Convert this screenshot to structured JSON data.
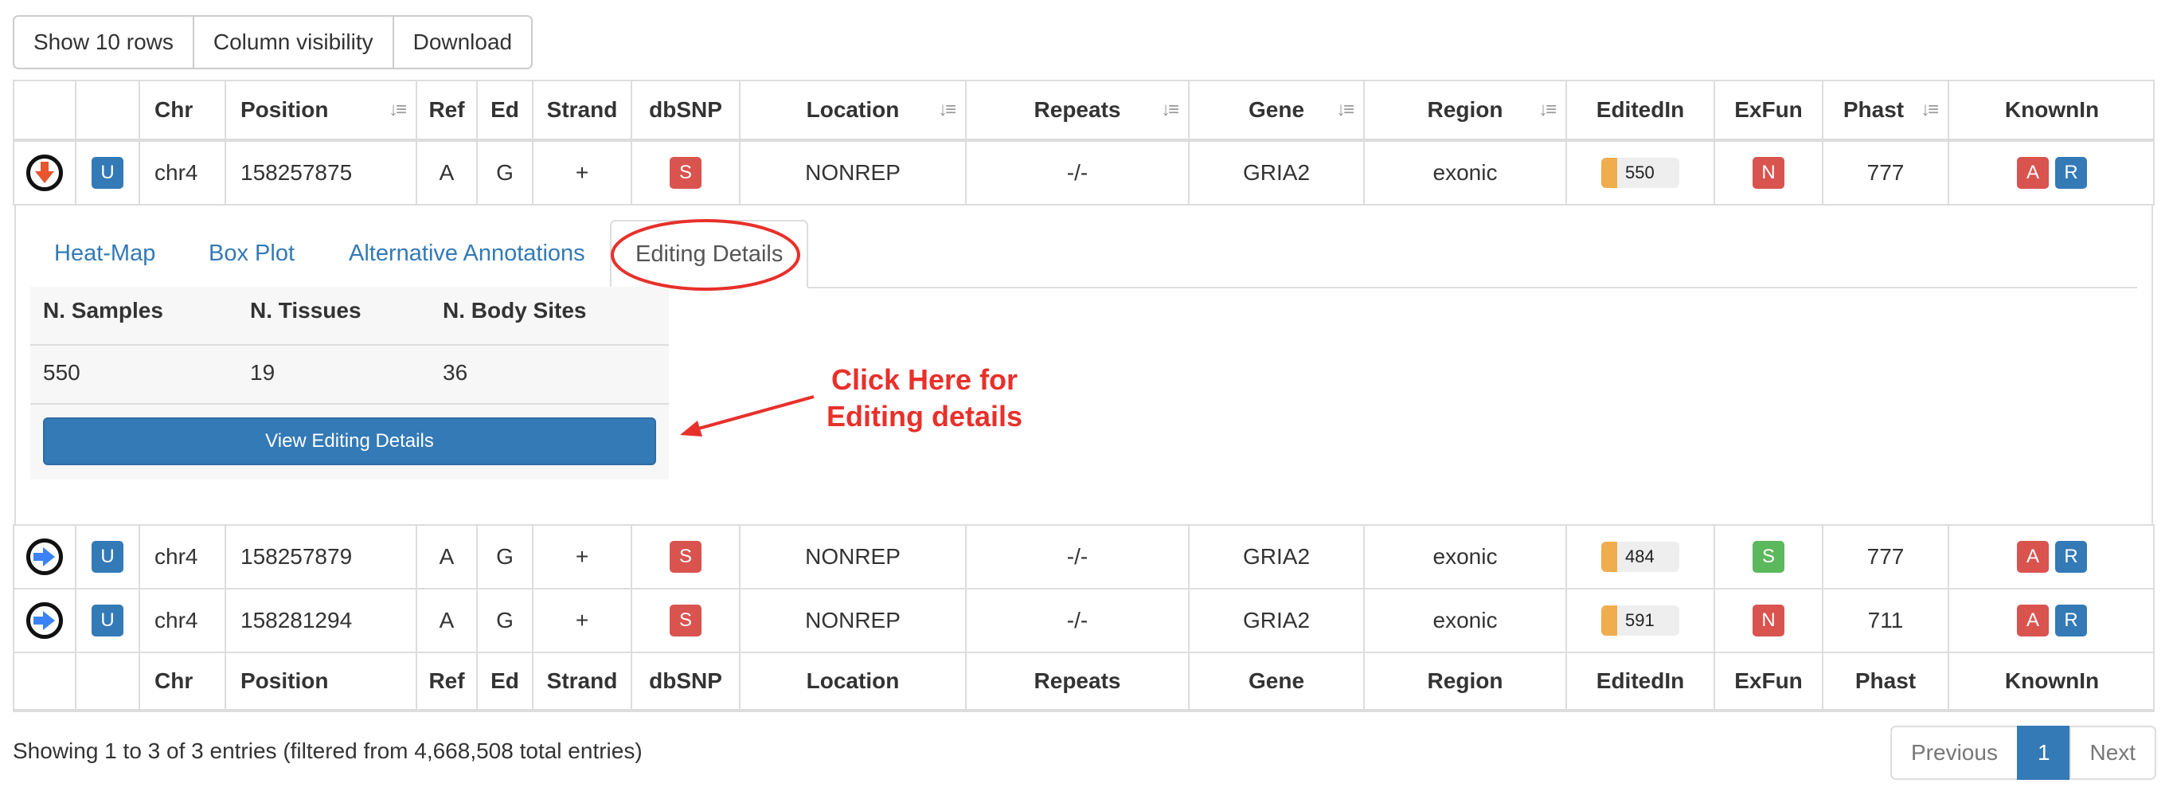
{
  "toolbar": {
    "show_rows": "Show 10 rows",
    "column_visibility": "Column visibility",
    "download": "Download"
  },
  "columns": [
    "",
    "",
    "Chr",
    "Position",
    "Ref",
    "Ed",
    "Strand",
    "dbSNP",
    "Location",
    "Repeats",
    "Gene",
    "Region",
    "EditedIn",
    "ExFun",
    "Phast",
    "KnownIn"
  ],
  "rows": [
    {
      "expand": "collapse",
      "u": "U",
      "chr": "chr4",
      "position": "158257875",
      "ref": "A",
      "ed": "G",
      "strand": "+",
      "dbsnp": "S",
      "location": "NONREP",
      "repeats": "-/-",
      "gene": "GRIA2",
      "region": "exonic",
      "editedin": "550",
      "exfun": "N",
      "phast": "777",
      "known_a": "A",
      "known_r": "R"
    },
    {
      "expand": "expand",
      "u": "U",
      "chr": "chr4",
      "position": "158257879",
      "ref": "A",
      "ed": "G",
      "strand": "+",
      "dbsnp": "S",
      "location": "NONREP",
      "repeats": "-/-",
      "gene": "GRIA2",
      "region": "exonic",
      "editedin": "484",
      "exfun": "S",
      "phast": "777",
      "known_a": "A",
      "known_r": "R"
    },
    {
      "expand": "expand",
      "u": "U",
      "chr": "chr4",
      "position": "158281294",
      "ref": "A",
      "ed": "G",
      "strand": "+",
      "dbsnp": "S",
      "location": "NONREP",
      "repeats": "-/-",
      "gene": "GRIA2",
      "region": "exonic",
      "editedin": "591",
      "exfun": "N",
      "phast": "711",
      "known_a": "A",
      "known_r": "R"
    }
  ],
  "detail": {
    "tabs": [
      "Heat-Map",
      "Box Plot",
      "Alternative Annotations",
      "Editing Details"
    ],
    "active_tab": "Editing Details",
    "headers": [
      "N. Samples",
      "N. Tissues",
      "N. Body Sites"
    ],
    "values": [
      "550",
      "19",
      "36"
    ],
    "view_button": "View Editing Details"
  },
  "annotation": {
    "line1": "Click Here for",
    "line2": "Editing details"
  },
  "footer": {
    "info": "Showing 1 to 3 of 3 entries (filtered from 4,668,508 total entries)",
    "previous": "Previous",
    "page": "1",
    "next": "Next"
  },
  "colors": {
    "red_label": "#d9534f",
    "blue_label": "#337ab7",
    "green_label": "#5cb85c",
    "bar_fill": "#f0ad4e",
    "annotation": "#e8302a"
  }
}
